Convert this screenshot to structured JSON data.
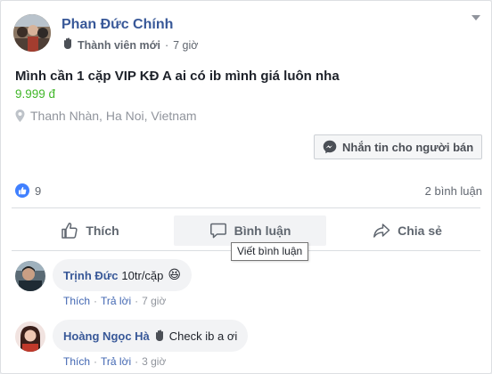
{
  "post": {
    "author_name": "Phan Đức Chính",
    "badge_label": "Thành viên mới",
    "time": "7 giờ",
    "listing_title": "Mình cần 1 cặp VIP KĐ A ai có ib mình giá luôn nha",
    "price": "9.999 đ",
    "location": "Thanh Nhàn, Ha Noi, Vietnam",
    "message_seller_label": "Nhắn tin cho người bán"
  },
  "stats": {
    "like_count": "9",
    "comment_count": "2 bình luận"
  },
  "actions": {
    "like_label": "Thích",
    "comment_label": "Bình luận",
    "share_label": "Chia sẻ",
    "comment_tooltip": "Viết bình luận"
  },
  "comments": [
    {
      "author": "Trịnh Đức",
      "text": "10tr/cặp",
      "emoji": "😆",
      "like_label": "Thích",
      "reply_label": "Trả lời",
      "time": "7 giờ"
    },
    {
      "author": "Hoàng Ngọc Hà",
      "text": "Check ib a ơi",
      "like_label": "Thích",
      "reply_label": "Trả lời",
      "time": "3 giờ"
    }
  ],
  "colors": {
    "link_blue": "#385898",
    "price_green": "#42b72a",
    "like_blue": "#4080ff"
  }
}
